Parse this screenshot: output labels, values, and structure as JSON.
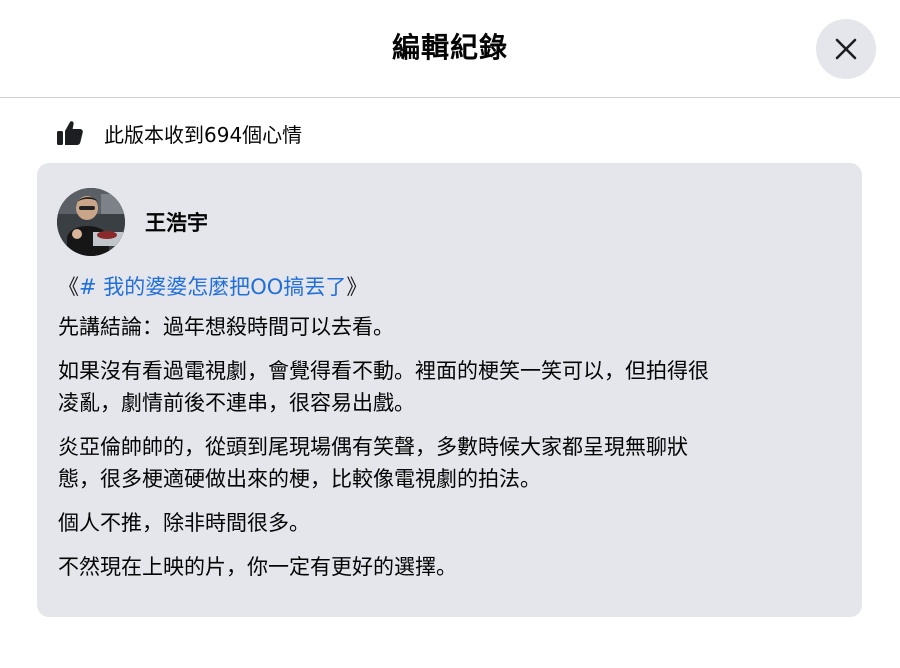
{
  "header": {
    "title": "編輯紀錄"
  },
  "close": {
    "icon": "close-icon"
  },
  "reactions": {
    "icon": "thumbs-up-icon",
    "text": "此版本收到694個心情"
  },
  "post": {
    "author": "王浩宇",
    "title": {
      "open": "《",
      "hashtag": "# 我的婆婆怎麼把OO搞丟了",
      "close": "》"
    },
    "paragraphs": [
      {
        "lines": [
          "先講結論：過年想殺時間可以去看。"
        ]
      },
      {
        "lines": [
          "如果沒有看過電視劇，會覺得看不動。裡面的梗笑一笑可以，但拍得很",
          "凌亂，劇情前後不連串，很容易出戲。"
        ]
      },
      {
        "lines": [
          "炎亞倫帥帥的，從頭到尾現場偶有笑聲，多數時候大家都呈現無聊狀",
          "態，很多梗適硬做出來的梗，比較像電視劇的拍法。"
        ]
      },
      {
        "lines": [
          "個人不推，除非時間很多。"
        ]
      },
      {
        "lines": [
          "不然現在上映的片，你一定有更好的選擇。"
        ]
      }
    ]
  }
}
